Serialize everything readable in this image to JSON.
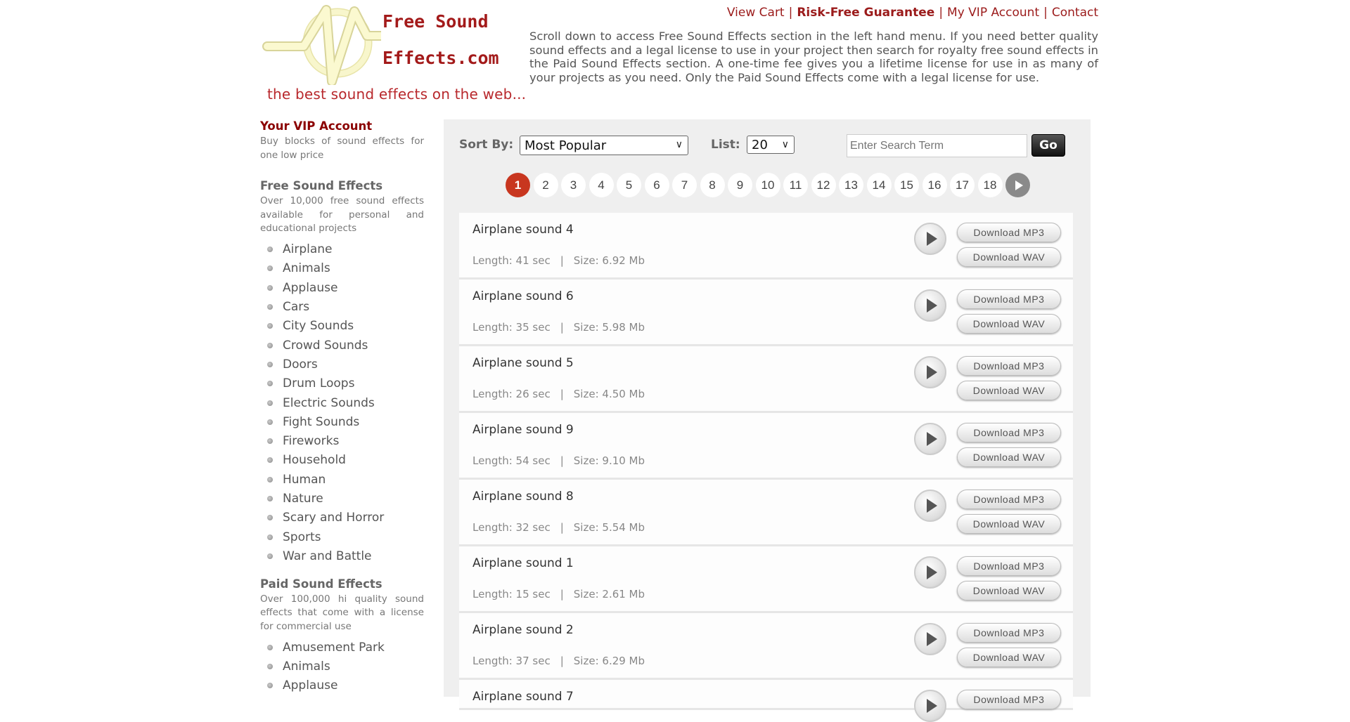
{
  "header": {
    "logo_line1": "Free Sound",
    "logo_line2": "Effects.com",
    "tagline": "the best sound effects on the web...",
    "nav": [
      {
        "label": "View Cart",
        "bold": false
      },
      {
        "label": "Risk-Free Guarantee",
        "bold": true
      },
      {
        "label": "My VIP Account",
        "bold": false
      },
      {
        "label": "Contact",
        "bold": false
      }
    ],
    "intro": "Scroll down to access Free Sound Effects section in the left hand menu. If you need better quality sound effects and a legal license to use in your project then search for royalty free sound effects in the Paid Sound Effects section. A one-time fee gives you a lifetime license for use in as many of your projects as you need. Only the Paid Sound Effects come with a legal license for use."
  },
  "sidebar": {
    "vip": {
      "title": "Your VIP Account",
      "desc": "Buy blocks of sound effects for one low price"
    },
    "free": {
      "title": "Free Sound Effects",
      "desc": "Over 10,000 free sound effects available for personal and educational projects",
      "items": [
        "Airplane",
        "Animals",
        "Applause",
        "Cars",
        "City Sounds",
        "Crowd Sounds",
        "Doors",
        "Drum Loops",
        "Electric Sounds",
        "Fight Sounds",
        "Fireworks",
        "Household",
        "Human",
        "Nature",
        "Scary and Horror",
        "Sports",
        "War and Battle"
      ]
    },
    "paid": {
      "title": "Paid Sound Effects",
      "desc": "Over 100,000 hi quality sound effects that come with a license for commercial use",
      "items": [
        "Amusement Park",
        "Animals",
        "Applause"
      ]
    }
  },
  "toolbar": {
    "sort_label": "Sort By:",
    "sort_value": "Most Popular",
    "list_label": "List:",
    "list_value": "20",
    "search_placeholder": "Enter Search Term",
    "go_label": "Go"
  },
  "pagination": {
    "current": 1,
    "pages": [
      "1",
      "2",
      "3",
      "4",
      "5",
      "6",
      "7",
      "8",
      "9",
      "10",
      "11",
      "12",
      "13",
      "14",
      "15",
      "16",
      "17",
      "18"
    ]
  },
  "results": {
    "mp3_label": "Download MP3",
    "wav_label": "Download WAV",
    "items": [
      {
        "title": "Airplane sound 4",
        "length": "Length: 41 sec",
        "size": "Size: 6.92 Mb"
      },
      {
        "title": "Airplane sound 6",
        "length": "Length: 35 sec",
        "size": "Size: 5.98 Mb"
      },
      {
        "title": "Airplane sound 5",
        "length": "Length: 26 sec",
        "size": "Size: 4.50 Mb"
      },
      {
        "title": "Airplane sound 9",
        "length": "Length: 54 sec",
        "size": "Size: 9.10 Mb"
      },
      {
        "title": "Airplane sound 8",
        "length": "Length: 32 sec",
        "size": "Size: 5.54 Mb"
      },
      {
        "title": "Airplane sound 1",
        "length": "Length: 15 sec",
        "size": "Size: 2.61 Mb"
      },
      {
        "title": "Airplane sound 2",
        "length": "Length: 37 sec",
        "size": "Size: 6.29 Mb"
      },
      {
        "title": "Airplane sound 7",
        "length": "",
        "size": ""
      }
    ]
  }
}
